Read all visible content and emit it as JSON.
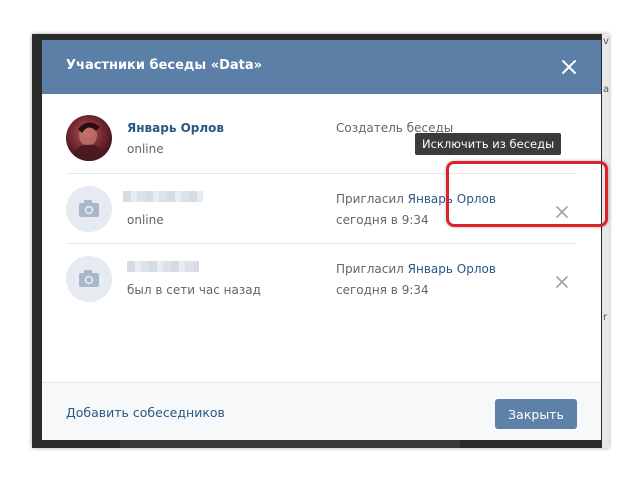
{
  "background": {
    "right_letters": [
      "v",
      "a",
      "r"
    ]
  },
  "modal": {
    "title": "Участники беседы «Data»",
    "close_icon": "close-icon"
  },
  "members": [
    {
      "name": "Январь Орлов",
      "status": "online",
      "role": "Создатель беседы",
      "avatar": "user-photo"
    },
    {
      "name": "",
      "status": "online",
      "invited_label": "Пригласил ",
      "invited_by": "Январь Орлов",
      "time": "сегодня в 9:34",
      "avatar": "camera-icon"
    },
    {
      "name": "",
      "status": "был в сети час назад",
      "invited_label": "Пригласил ",
      "invited_by": "Январь Орлов",
      "time": "сегодня в 9:34",
      "avatar": "camera-icon"
    }
  ],
  "tooltip": {
    "text": "Исключить из беседы"
  },
  "footer": {
    "add_label": "Добавить собеседников",
    "close_label": "Закрыть"
  },
  "colors": {
    "header": "#5b7fa6",
    "link": "#2a5885",
    "button": "#5e81a8",
    "highlight": "#d9222a"
  }
}
